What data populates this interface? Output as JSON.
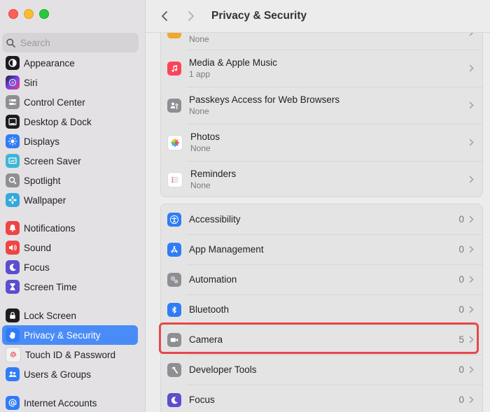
{
  "window": {
    "title": "Privacy & Security"
  },
  "search": {
    "placeholder": "Search"
  },
  "sidebar": {
    "items": [
      {
        "label": "Appearance",
        "icon": "appearance-icon",
        "color": "#1c1c1e"
      },
      {
        "label": "Siri",
        "icon": "siri-icon",
        "color": "#7b3fe4"
      },
      {
        "label": "Control Center",
        "icon": "control-center-icon",
        "color": "#8e8e93"
      },
      {
        "label": "Desktop & Dock",
        "icon": "dock-icon",
        "color": "#1c1c1e"
      },
      {
        "label": "Displays",
        "icon": "sun-icon",
        "color": "#2f7cf6"
      },
      {
        "label": "Screen Saver",
        "icon": "screen-saver-icon",
        "color": "#3fb5d6"
      },
      {
        "label": "Spotlight",
        "icon": "magnifier-icon",
        "color": "#8e8e93"
      },
      {
        "label": "Wallpaper",
        "icon": "flower-icon",
        "color": "#34aadc"
      },
      {
        "label": "Notifications",
        "icon": "bell-icon",
        "color": "#ef4444"
      },
      {
        "label": "Sound",
        "icon": "speaker-icon",
        "color": "#ef4444"
      },
      {
        "label": "Focus",
        "icon": "moon-icon",
        "color": "#5b4ecf"
      },
      {
        "label": "Screen Time",
        "icon": "hourglass-icon",
        "color": "#5b4ecf"
      },
      {
        "label": "Lock Screen",
        "icon": "lock-icon",
        "color": "#1c1c1e"
      },
      {
        "label": "Privacy & Security",
        "icon": "hand-icon",
        "color": "#2f7cf6"
      },
      {
        "label": "Touch ID & Password",
        "icon": "fingerprint-icon",
        "color": "#f2f2f2"
      },
      {
        "label": "Users & Groups",
        "icon": "users-icon",
        "color": "#2f7cf6"
      },
      {
        "label": "Internet Accounts",
        "icon": "at-icon",
        "color": "#2f7cf6"
      }
    ]
  },
  "group1": [
    {
      "name": "",
      "sub": "None"
    },
    {
      "name": "Media & Apple Music",
      "sub": "1 app"
    },
    {
      "name": "Passkeys Access for Web Browsers",
      "sub": "None"
    },
    {
      "name": "Photos",
      "sub": "None"
    },
    {
      "name": "Reminders",
      "sub": "None"
    }
  ],
  "group2": [
    {
      "name": "Accessibility",
      "count": "0"
    },
    {
      "name": "App Management",
      "count": "0"
    },
    {
      "name": "Automation",
      "count": "0"
    },
    {
      "name": "Bluetooth",
      "count": "0"
    },
    {
      "name": "Camera",
      "count": "5"
    },
    {
      "name": "Developer Tools",
      "count": "0"
    },
    {
      "name": "Focus",
      "count": "0"
    }
  ],
  "colors": {
    "accent": "#4a8cf7",
    "highlight": "#e8474a"
  }
}
